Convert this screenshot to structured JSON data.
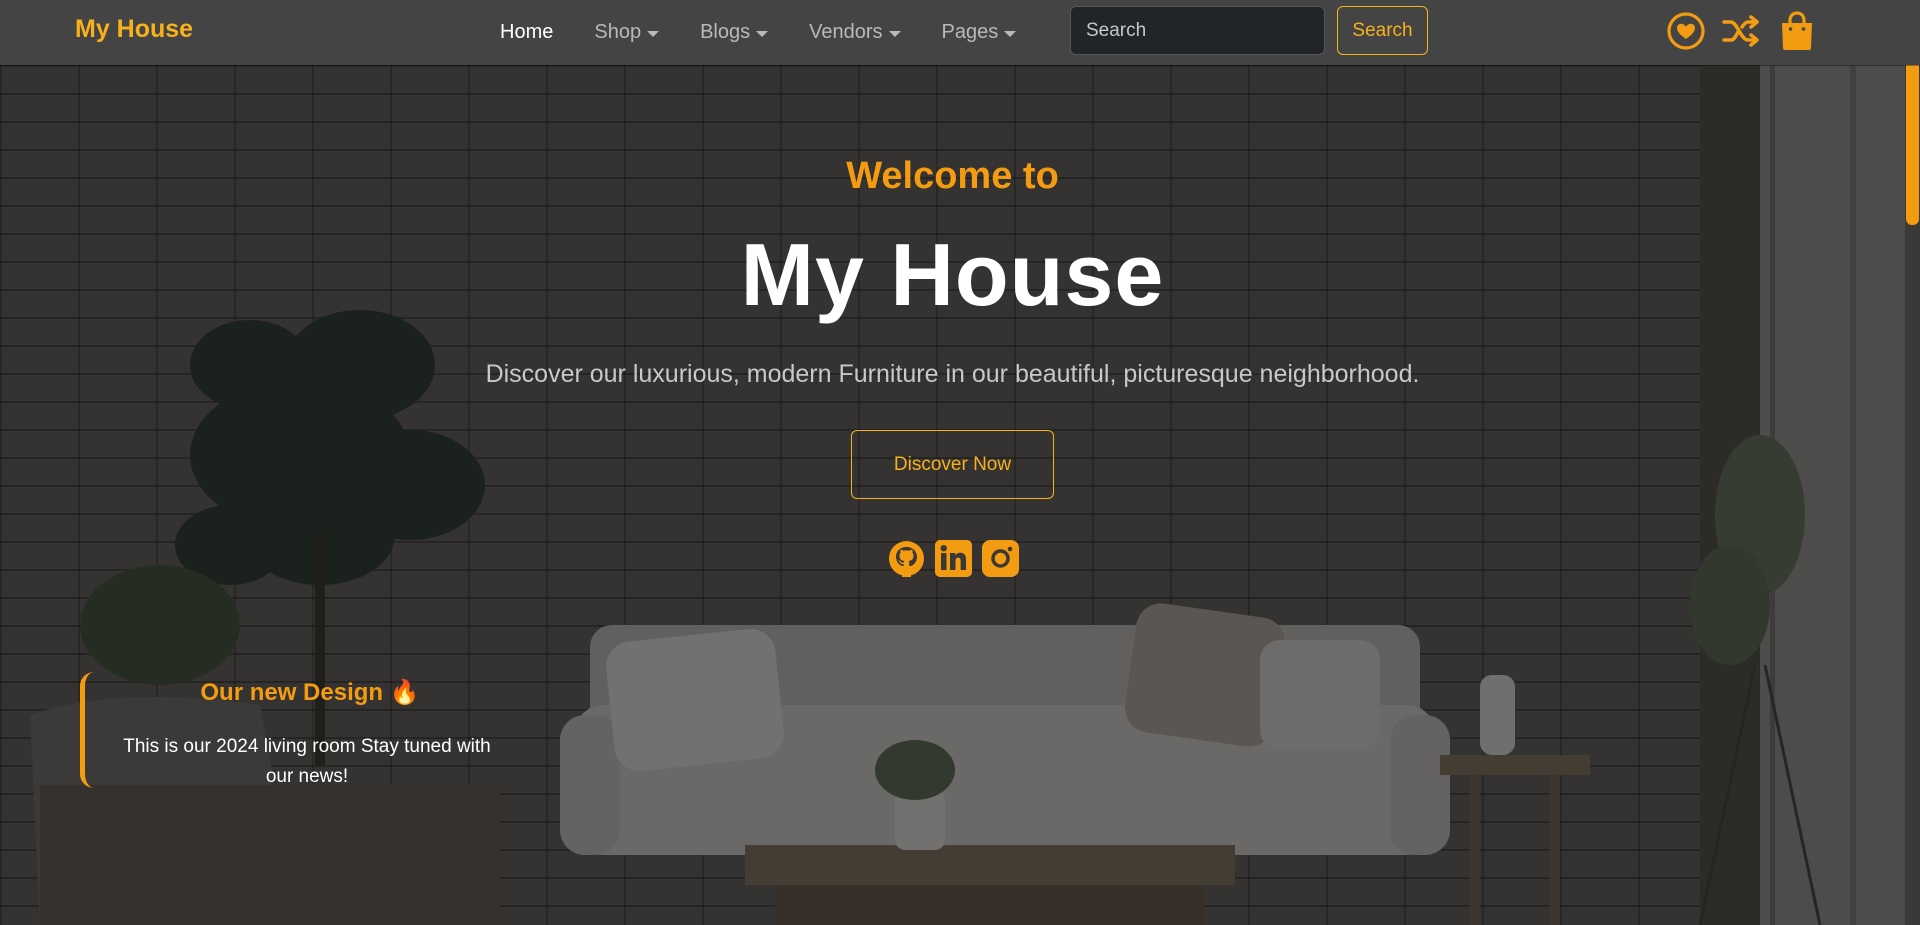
{
  "brand": "My House",
  "nav": {
    "items": [
      {
        "label": "Home",
        "active": true,
        "dropdown": false
      },
      {
        "label": "Shop",
        "active": false,
        "dropdown": true
      },
      {
        "label": "Blogs",
        "active": false,
        "dropdown": true
      },
      {
        "label": "Vendors",
        "active": false,
        "dropdown": true
      },
      {
        "label": "Pages",
        "active": false,
        "dropdown": true
      }
    ],
    "search_placeholder": "Search",
    "search_button": "Search",
    "icons": [
      "heart-icon",
      "shuffle-icon",
      "shopping-bag-icon"
    ]
  },
  "hero": {
    "welcome": "Welcome to",
    "title": "My House",
    "subtitle": "Discover our luxurious, modern Furniture in our beautiful, picturesque neighborhood.",
    "cta": "Discover Now",
    "socials": [
      "github-icon",
      "linkedin-icon",
      "instagram-icon"
    ]
  },
  "news": {
    "title": "Our new Design 🔥",
    "text": "This is our 2024 living room Stay tuned with our news!"
  },
  "colors": {
    "accent": "#f7b21b",
    "accent_dark": "#f39c12",
    "navbar_bg": "#444444",
    "search_bg": "#212529"
  }
}
